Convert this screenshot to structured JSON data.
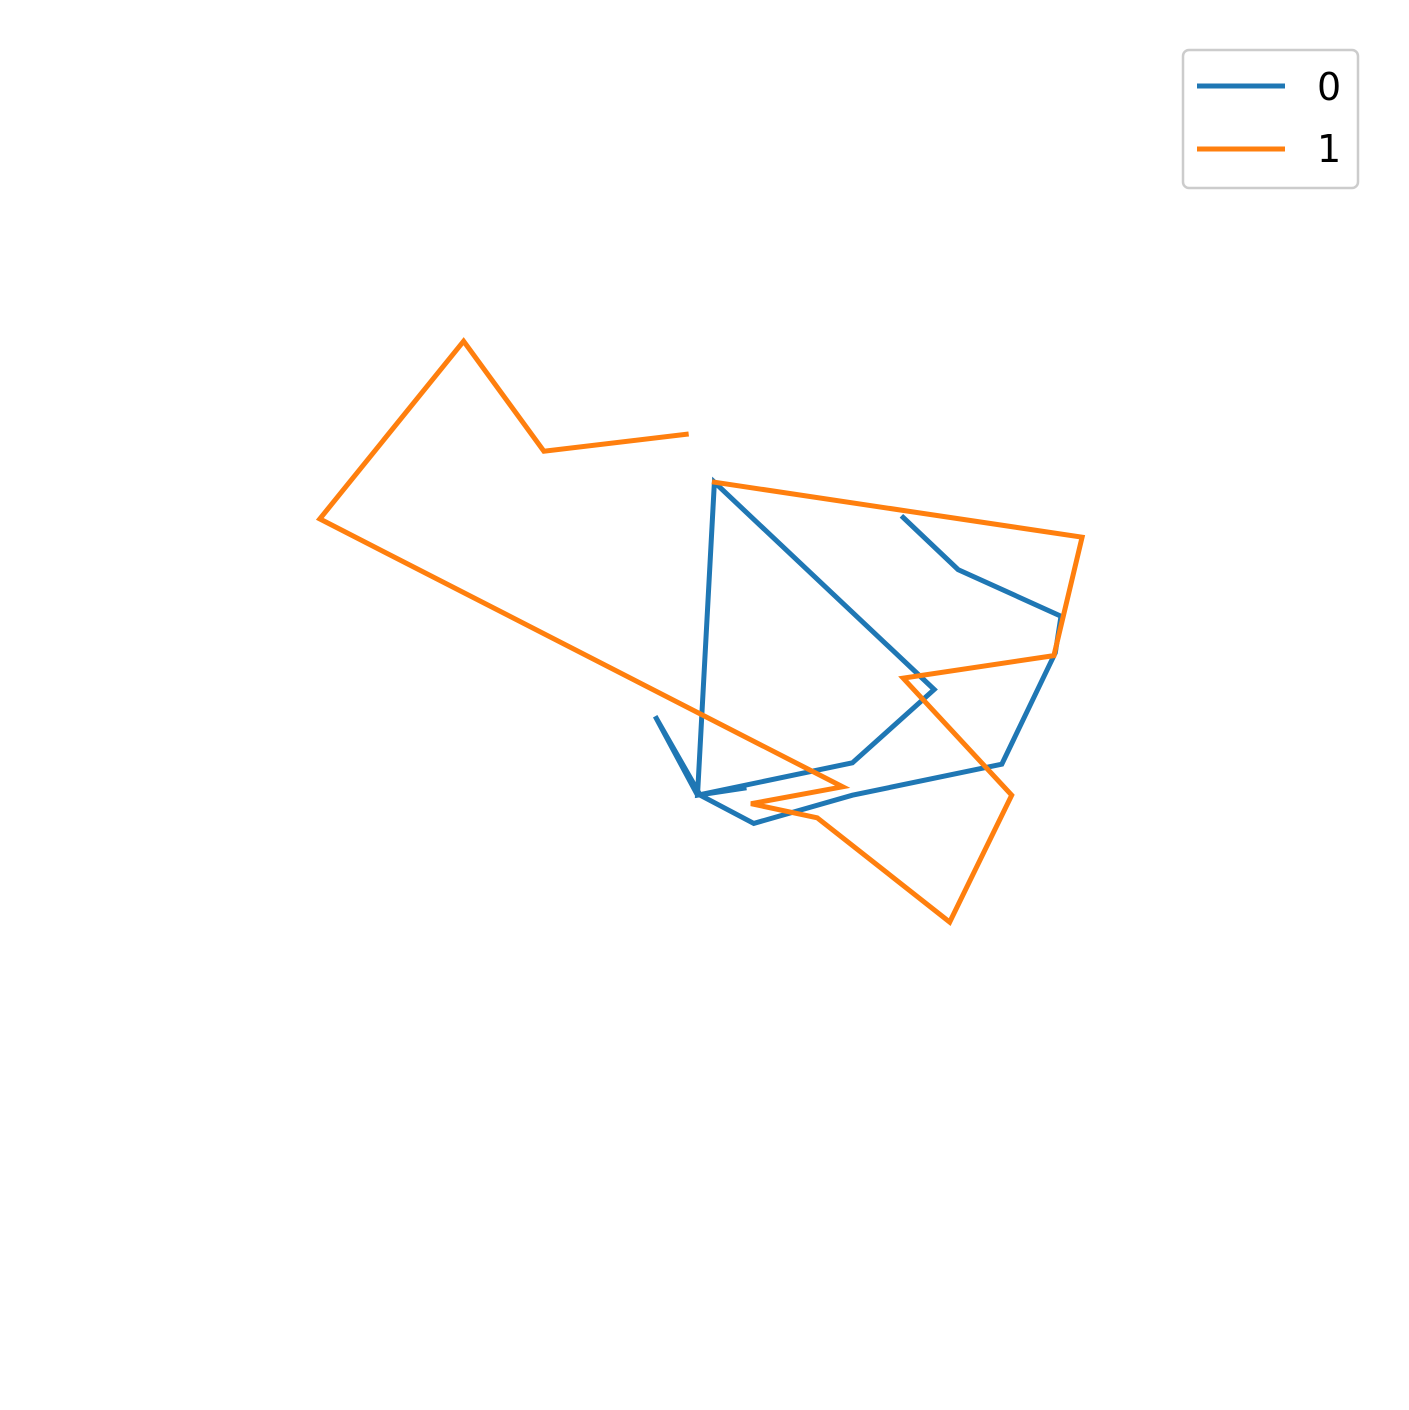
{
  "chart_data": {
    "type": "line",
    "title": "",
    "xlabel": "",
    "ylabel": "",
    "axes_visible": false,
    "grid": false,
    "legend_position": "top-right",
    "xlim": [
      0,
      1
    ],
    "ylim": [
      0,
      1
    ],
    "series": [
      {
        "name": "0",
        "color": "#1f77b4",
        "points": [
          [
            0.641,
            0.633
          ],
          [
            0.68,
            0.596
          ],
          [
            0.753,
            0.563
          ],
          [
            0.749,
            0.537
          ],
          [
            0.711,
            0.458
          ],
          [
            0.605,
            0.436
          ],
          [
            0.535,
            0.416
          ],
          [
            0.497,
            0.436
          ],
          [
            0.465,
            0.492
          ],
          [
            0.495,
            0.436
          ],
          [
            0.605,
            0.459
          ],
          [
            0.663,
            0.511
          ],
          [
            0.507,
            0.658
          ],
          [
            0.495,
            0.436
          ],
          [
            0.528,
            0.441
          ]
        ]
      },
      {
        "name": "1",
        "color": "#ff7f0e",
        "points": [
          [
            0.487,
            0.692
          ],
          [
            0.386,
            0.68
          ],
          [
            0.329,
            0.758
          ],
          [
            0.227,
            0.632
          ],
          [
            0.598,
            0.442
          ],
          [
            0.533,
            0.43
          ],
          [
            0.58,
            0.42
          ],
          [
            0.674,
            0.346
          ],
          [
            0.718,
            0.436
          ],
          [
            0.641,
            0.519
          ],
          [
            0.748,
            0.535
          ],
          [
            0.768,
            0.619
          ],
          [
            0.507,
            0.658
          ]
        ]
      }
    ]
  }
}
